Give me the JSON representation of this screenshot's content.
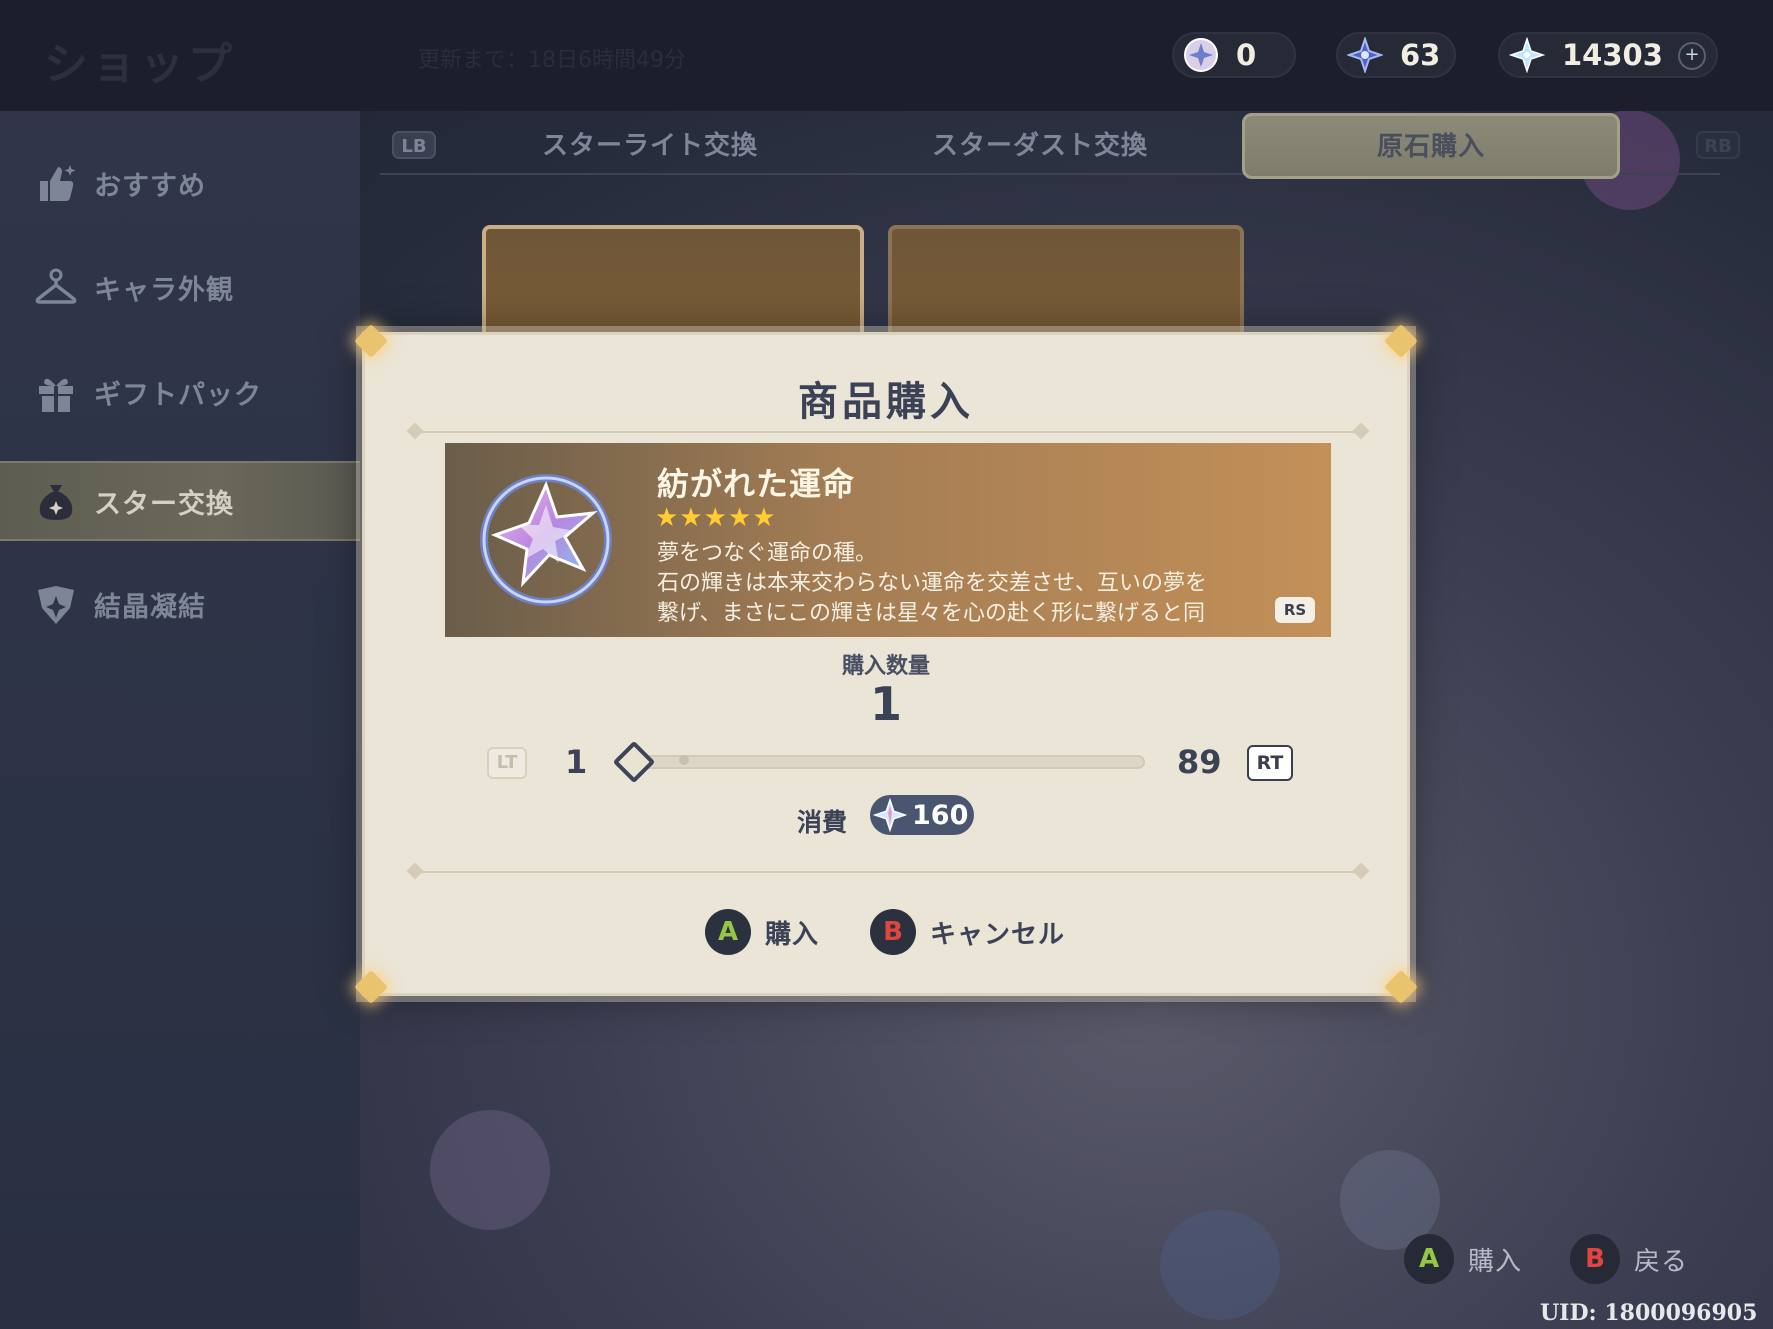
{
  "header": {
    "title": "ショップ",
    "refresh_text": "更新まで：18日6時間49分",
    "currencies": [
      {
        "icon": "intertwined-fate-icon",
        "value": "0"
      },
      {
        "icon": "masterless-starglitter-icon",
        "value": "63"
      },
      {
        "icon": "masterless-stardust-icon",
        "value": "14303"
      }
    ],
    "add_label": "+"
  },
  "sidebar": {
    "items": [
      {
        "icon": "thumbs-up-icon",
        "label": "おすすめ"
      },
      {
        "icon": "hanger-icon",
        "label": "キャラ外観"
      },
      {
        "icon": "gift-icon",
        "label": "ギフトパック"
      },
      {
        "icon": "money-bag-icon",
        "label": "スター交換",
        "active": true
      },
      {
        "icon": "crystal-emblem-icon",
        "label": "結晶凝結"
      }
    ]
  },
  "tabs": {
    "lb": "LB",
    "rb": "RB",
    "items": [
      {
        "label": "スターライト交換"
      },
      {
        "label": "スターダスト交換"
      },
      {
        "label": "原石購入",
        "active": true
      }
    ]
  },
  "dialog": {
    "title": "商品購入",
    "item": {
      "name": "紡がれた運命",
      "stars": "★★★★★",
      "rarity": 5,
      "icon": "intertwined-fate-icon",
      "description_line1": "夢をつなぐ運命の種。",
      "description_line2": "石の輝きは本来交わらない運命を交差させ、互いの夢を",
      "description_line3": "繋げ、まさにこの輝きは星々を心の赴く形に繋げると同"
    },
    "rs_tag": "RS",
    "quantity_label": "購入数量",
    "quantity": "1",
    "slider": {
      "lt": "LT",
      "rt": "RT",
      "min": "1",
      "max": "89"
    },
    "cost_label": "消費",
    "cost_value": "160",
    "cost_icon": "masterless-stardust-icon",
    "buttons": {
      "confirm_key": "A",
      "confirm_label": "購入",
      "cancel_key": "B",
      "cancel_label": "キャンセル"
    }
  },
  "footer": {
    "confirm_key": "A",
    "confirm_label": "購入",
    "back_key": "B",
    "back_label": "戻る",
    "uid": "UID: 1800096905"
  },
  "colors": {
    "accent_gold": "#e9c36e",
    "dialog_bg": "#ebe5d8",
    "item_bg": "#c39058",
    "star_color": "#ffcc32",
    "a_button": "#95c745",
    "b_button": "#e2443f"
  }
}
